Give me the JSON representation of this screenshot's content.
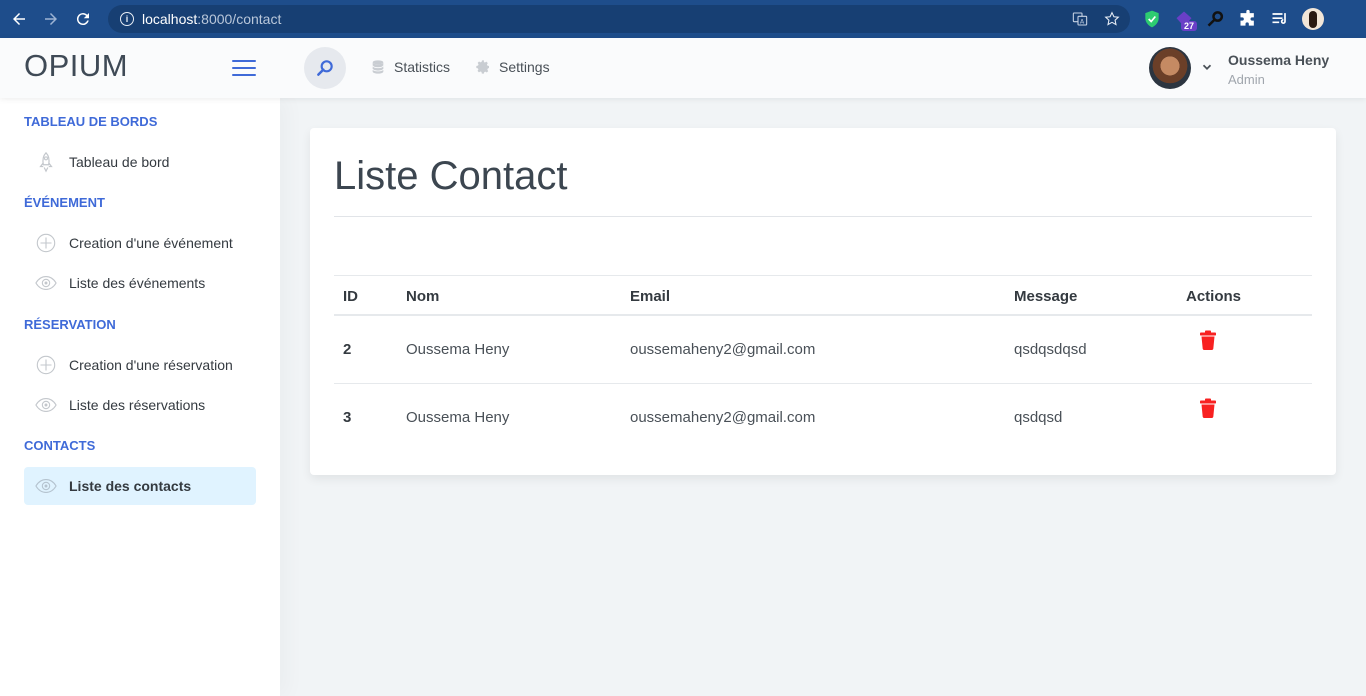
{
  "browser": {
    "url_host": "localhost",
    "url_path": ":8000/contact",
    "extension_badge": "27"
  },
  "header": {
    "logo": "OPIUM",
    "links": [
      {
        "label": "Statistics",
        "icon": "database-icon"
      },
      {
        "label": "Settings",
        "icon": "gear-icon"
      }
    ],
    "user": {
      "name": "Oussema Heny",
      "role": "Admin"
    }
  },
  "sidebar": {
    "sections": [
      {
        "title": "TABLEAU DE BORDS",
        "items": [
          {
            "label": "Tableau de bord",
            "icon": "rocket-icon"
          }
        ]
      },
      {
        "title": "ÉVÉNEMENT",
        "items": [
          {
            "label": "Creation d'une événement",
            "icon": "plus-circle-icon"
          },
          {
            "label": "Liste des événements",
            "icon": "eye-icon"
          }
        ]
      },
      {
        "title": "RÉSERVATION",
        "items": [
          {
            "label": "Creation d'une réservation",
            "icon": "plus-circle-icon"
          },
          {
            "label": "Liste des réservations",
            "icon": "eye-icon"
          }
        ]
      },
      {
        "title": "CONTACTS",
        "items": [
          {
            "label": "Liste des contacts",
            "icon": "eye-icon",
            "active": true
          }
        ]
      }
    ]
  },
  "main": {
    "title": "Liste Contact",
    "table": {
      "columns": [
        "ID",
        "Nom",
        "Email",
        "Message",
        "Actions"
      ],
      "rows": [
        {
          "id": "2",
          "nom": "Oussema Heny",
          "email": "oussemaheny2@gmail.com",
          "message": "qsdqsdqsd"
        },
        {
          "id": "3",
          "nom": "Oussema Heny",
          "email": "oussemaheny2@gmail.com",
          "message": "qsdqsd"
        }
      ]
    }
  },
  "colors": {
    "accent": "#3f6ad8",
    "danger": "#f82121",
    "browser": "#1e4d8b"
  }
}
